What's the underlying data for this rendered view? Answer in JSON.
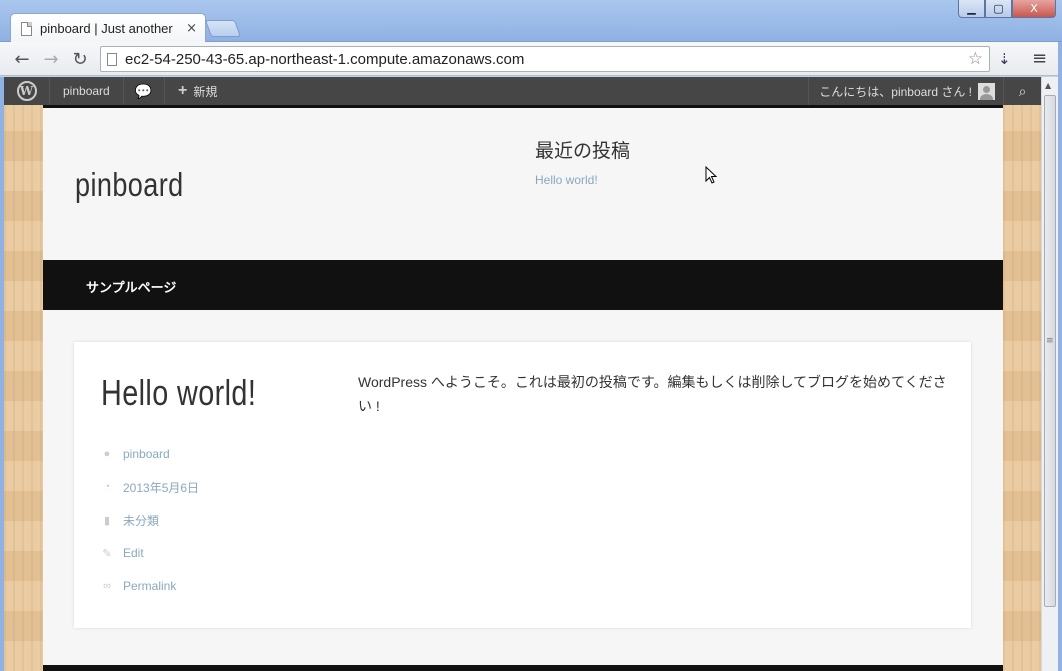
{
  "browser": {
    "tab_title": "pinboard | Just another",
    "tab_close": "×",
    "url": "ec2-54-250-43-65.ap-northeast-1.compute.amazonaws.com",
    "window_controls": {
      "minimize": "▁",
      "maximize": "▢",
      "close": "X"
    },
    "icons": {
      "back": "←",
      "forward": "→",
      "reload": "↻",
      "star": "☆",
      "extension": "⇣",
      "menu": "≡"
    }
  },
  "adminbar": {
    "site_name": "pinboard",
    "comments_icon": "💬",
    "new_plus": "+",
    "new_label": "新規",
    "greeting": "こんにちは、pinboard さん !",
    "search_icon": "⌕",
    "wp_logo": "W"
  },
  "site": {
    "title": "pinboard",
    "widget": {
      "title": "最近の投稿",
      "link": "Hello world!"
    },
    "nav": {
      "item": "サンプルページ"
    }
  },
  "post": {
    "title": "Hello world!",
    "meta": {
      "author": "pinboard",
      "date": "2013年5月6日",
      "category": "未分類",
      "edit": "Edit",
      "permalink": "Permalink"
    },
    "content": "WordPress へようこそ。これは最初の投稿です。編集もしくは削除してブログを始めてください !"
  }
}
